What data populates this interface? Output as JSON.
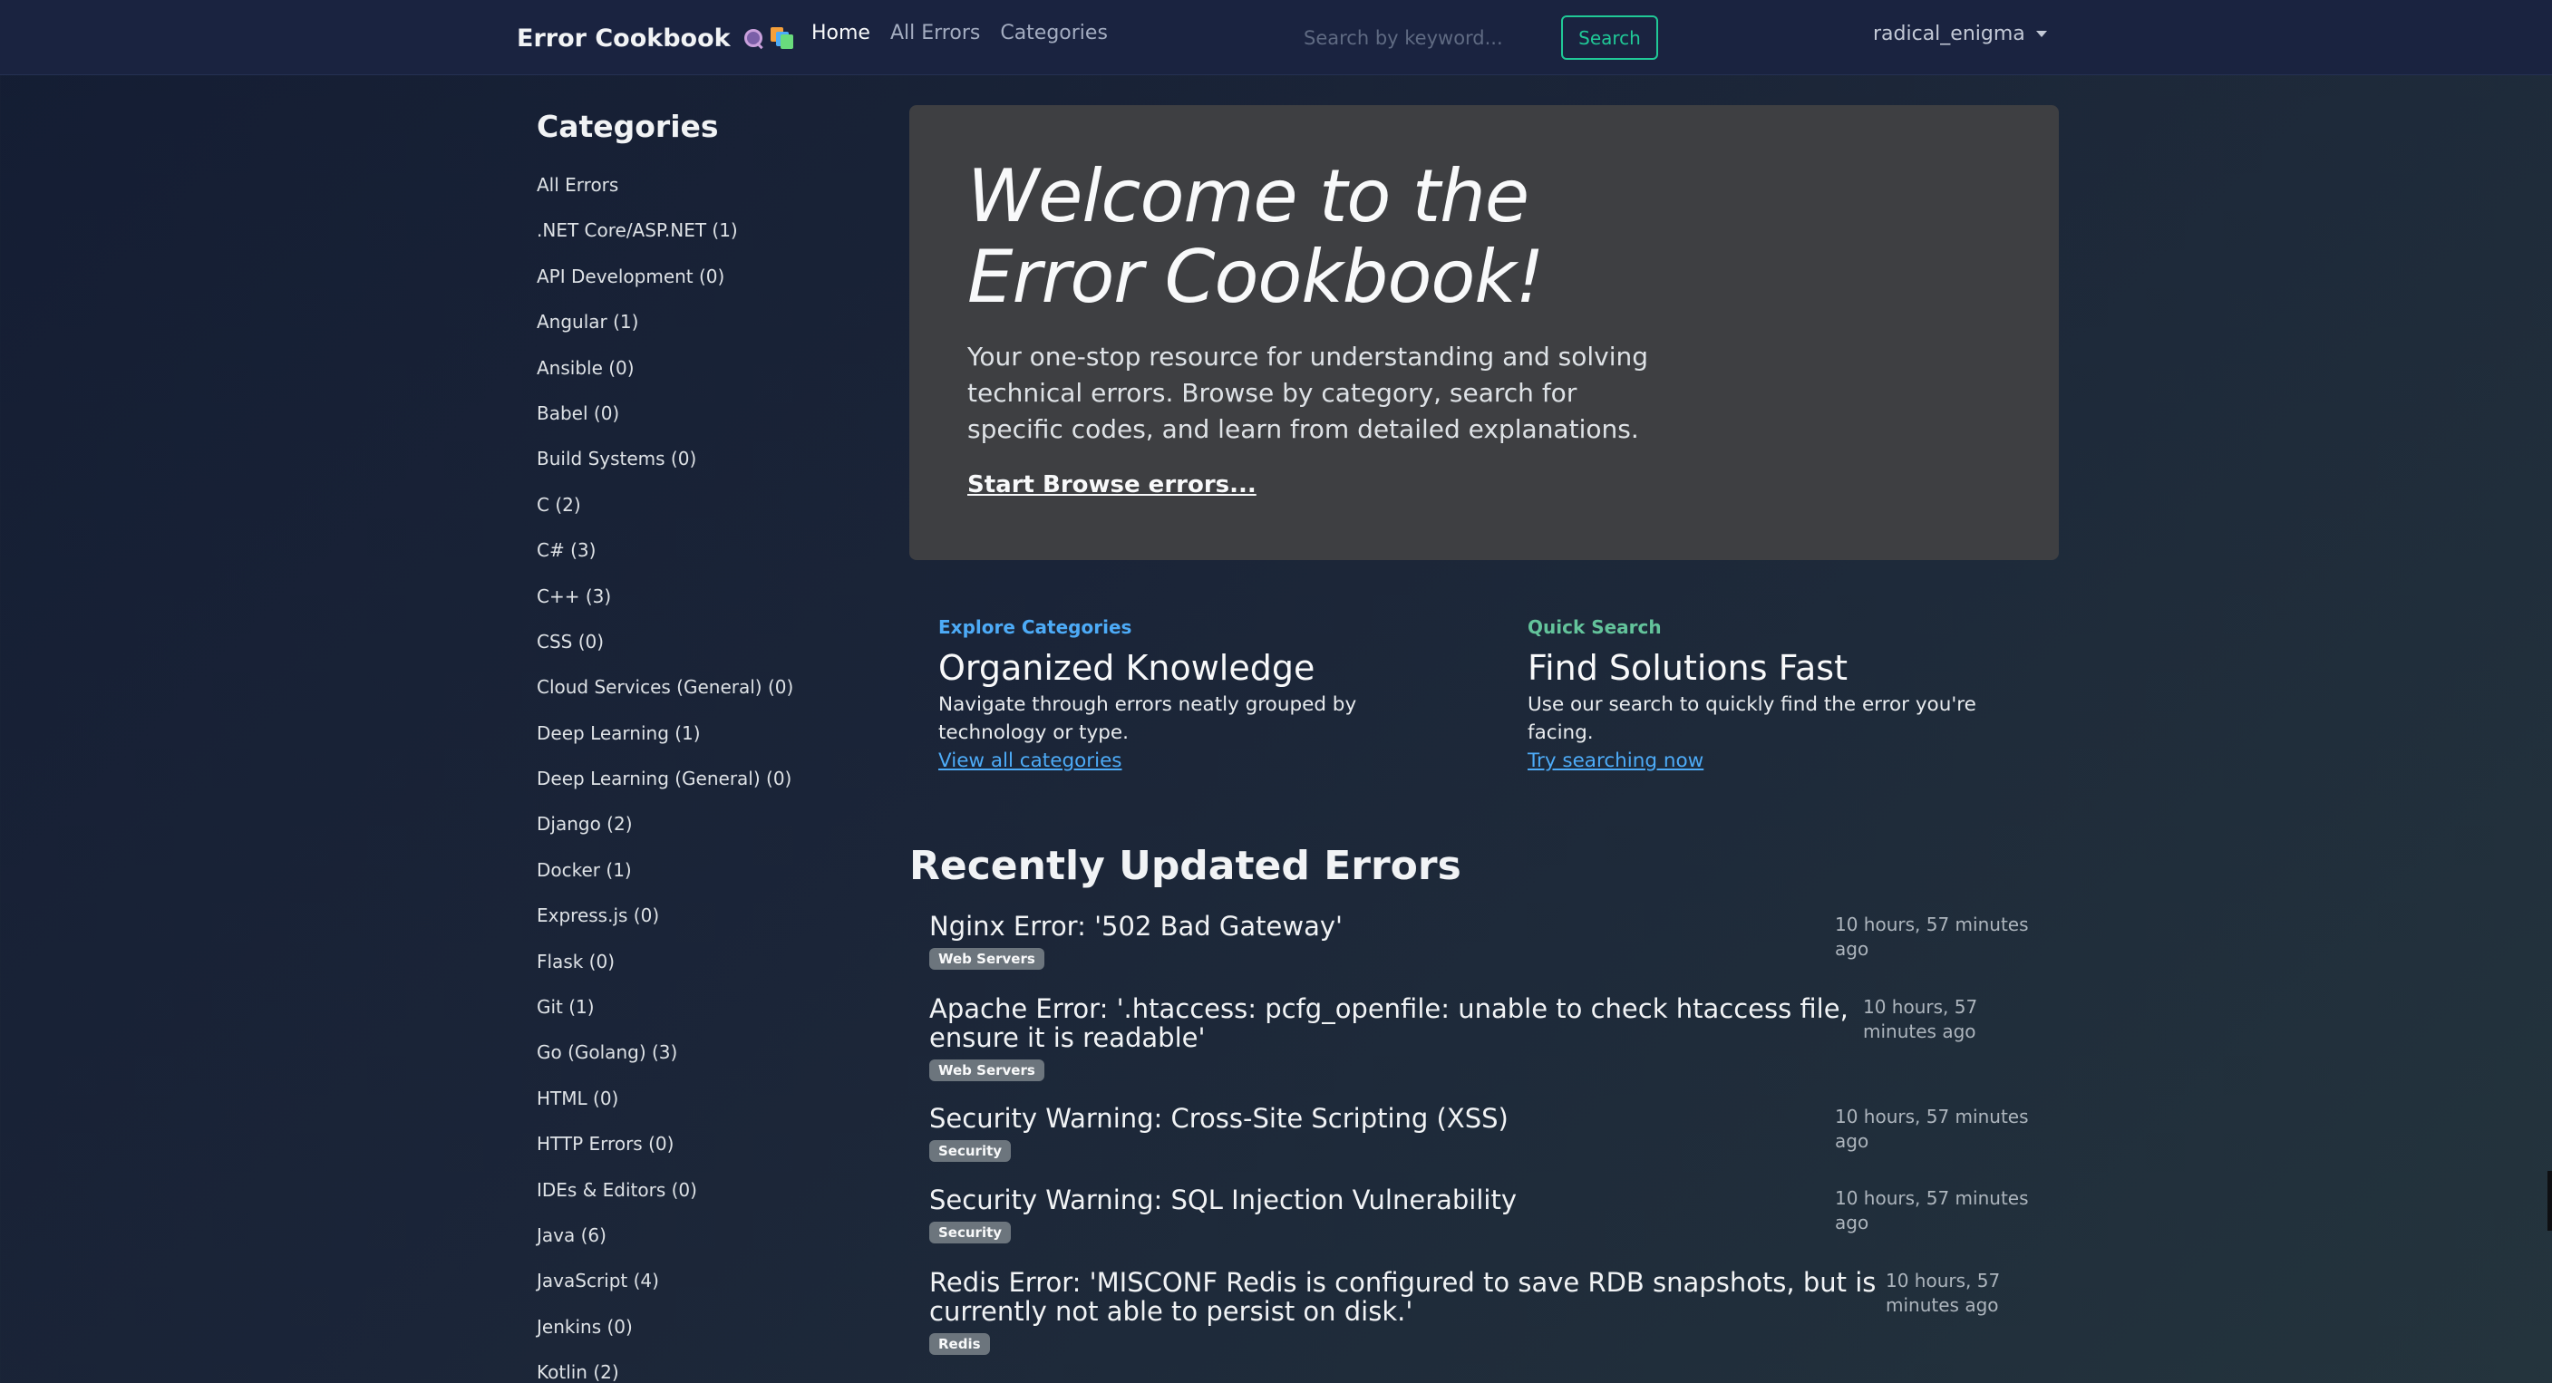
{
  "navbar": {
    "brand": "Error Cookbook",
    "brand_icons": [
      "magnifier-icon",
      "books-icon"
    ],
    "links": [
      "Home",
      "All Errors",
      "Categories"
    ],
    "active_link": "Home",
    "search_placeholder": "Search by keyword...",
    "search_button": "Search",
    "user": "radical_enigma"
  },
  "sidebar": {
    "title": "Categories",
    "items": [
      "All Errors",
      ".NET Core/ASP.NET (1)",
      "API Development (0)",
      "Angular (1)",
      "Ansible (0)",
      "Babel (0)",
      "Build Systems (0)",
      "C (2)",
      "C# (3)",
      "C++ (3)",
      "CSS (0)",
      "Cloud Services (General) (0)",
      "Deep Learning (1)",
      "Deep Learning (General) (0)",
      "Django (2)",
      "Docker (1)",
      "Express.js (0)",
      "Flask (0)",
      "Git (1)",
      "Go (Golang) (3)",
      "HTML (0)",
      "HTTP Errors (0)",
      "IDEs & Editors (0)",
      "Java (6)",
      "JavaScript (4)",
      "Jenkins (0)",
      "Kotlin (2)"
    ]
  },
  "hero": {
    "title_line1": "Welcome to the",
    "title_line2": "Error Cookbook!",
    "text": "Your one-stop resource for understanding and solving technical errors. Browse by category, search for specific codes, and learn from detailed explanations.",
    "link": "Start Browse errors..."
  },
  "features": [
    {
      "eyebrow": "Explore Categories",
      "title": "Organized Knowledge",
      "text": "Navigate through errors neatly grouped by technology or type.",
      "link": "View all categories"
    },
    {
      "eyebrow": "Quick Search",
      "title": "Find Solutions Fast",
      "text": "Use our search to quickly find the error you're facing.",
      "link": "Try searching now"
    }
  ],
  "recent": {
    "title": "Recently Updated Errors",
    "items": [
      {
        "title": "Nginx Error: '502 Bad Gateway'",
        "badge": "Web Servers",
        "time": "10 hours, 57 minutes ago"
      },
      {
        "title": "Apache Error: '.htaccess: pcfg_openfile: unable to check htaccess file, ensure it is readable'",
        "badge": "Web Servers",
        "time": "10 hours, 57 minutes ago"
      },
      {
        "title": "Security Warning: Cross-Site Scripting (XSS)",
        "badge": "Security",
        "time": "10 hours, 57 minutes ago"
      },
      {
        "title": "Security Warning: SQL Injection Vulnerability",
        "badge": "Security",
        "time": "10 hours, 57 minutes ago"
      },
      {
        "title": "Redis Error: 'MISCONF Redis is configured to save RDB snapshots, but is currently not able to persist on disk.'",
        "badge": "Redis",
        "time": "10 hours, 57 minutes ago"
      }
    ]
  }
}
